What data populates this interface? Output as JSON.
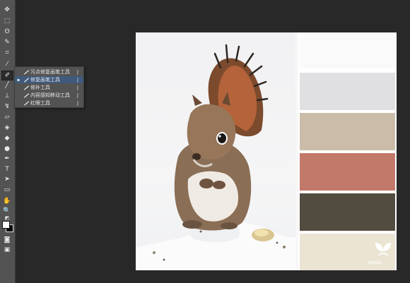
{
  "tools": [
    {
      "name": "move-tool-icon",
      "glyph": "✥"
    },
    {
      "name": "marquee-tool-icon",
      "glyph": "⬚"
    },
    {
      "name": "lasso-tool-icon",
      "glyph": "ʘ"
    },
    {
      "name": "quick-selection-tool-icon",
      "glyph": "✎"
    },
    {
      "name": "crop-tool-icon",
      "glyph": "⌗"
    },
    {
      "name": "eyedropper-tool-icon",
      "glyph": "⁄"
    },
    {
      "name": "healing-brush-tool-icon",
      "glyph": "✐"
    },
    {
      "name": "brush-tool-icon",
      "glyph": "╱"
    },
    {
      "name": "clone-stamp-tool-icon",
      "glyph": "⊥"
    },
    {
      "name": "history-brush-tool-icon",
      "glyph": "↯"
    },
    {
      "name": "eraser-tool-icon",
      "glyph": "▱"
    },
    {
      "name": "paint-bucket-tool-icon",
      "glyph": "◈"
    },
    {
      "name": "blur-tool-icon",
      "glyph": "◆"
    },
    {
      "name": "dodge-tool-icon",
      "glyph": "●"
    },
    {
      "name": "pen-tool-icon",
      "glyph": "✒"
    },
    {
      "name": "type-tool-icon",
      "glyph": "T"
    },
    {
      "name": "path-selection-tool-icon",
      "glyph": "➤"
    },
    {
      "name": "rectangle-tool-icon",
      "glyph": "▭"
    },
    {
      "name": "hand-tool-icon",
      "glyph": "✋"
    },
    {
      "name": "zoom-tool-icon",
      "glyph": "🔍"
    }
  ],
  "flyout": {
    "items": [
      {
        "label": "污点修复画笔工具",
        "shortcut": "J",
        "selected": false,
        "icon": "spot-healing-brush-icon"
      },
      {
        "label": "修复画笔工具",
        "shortcut": "J",
        "selected": true,
        "icon": "healing-brush-icon"
      },
      {
        "label": "修补工具",
        "shortcut": "J",
        "selected": false,
        "icon": "patch-tool-icon"
      },
      {
        "label": "内容感知移动工具",
        "shortcut": "J",
        "selected": false,
        "icon": "content-aware-move-icon"
      },
      {
        "label": "红眼工具",
        "shortcut": "J",
        "selected": false,
        "icon": "red-eye-tool-icon"
      }
    ]
  },
  "swatches": {
    "foreground": "#ffffff",
    "background": "#000000"
  },
  "palette": {
    "colors": [
      "#fafafa",
      "#e0e0e3",
      "#cbbcaa",
      "#c3796a",
      "#524b40",
      "#ebe4d3"
    ],
    "logo_text": "seeds"
  }
}
